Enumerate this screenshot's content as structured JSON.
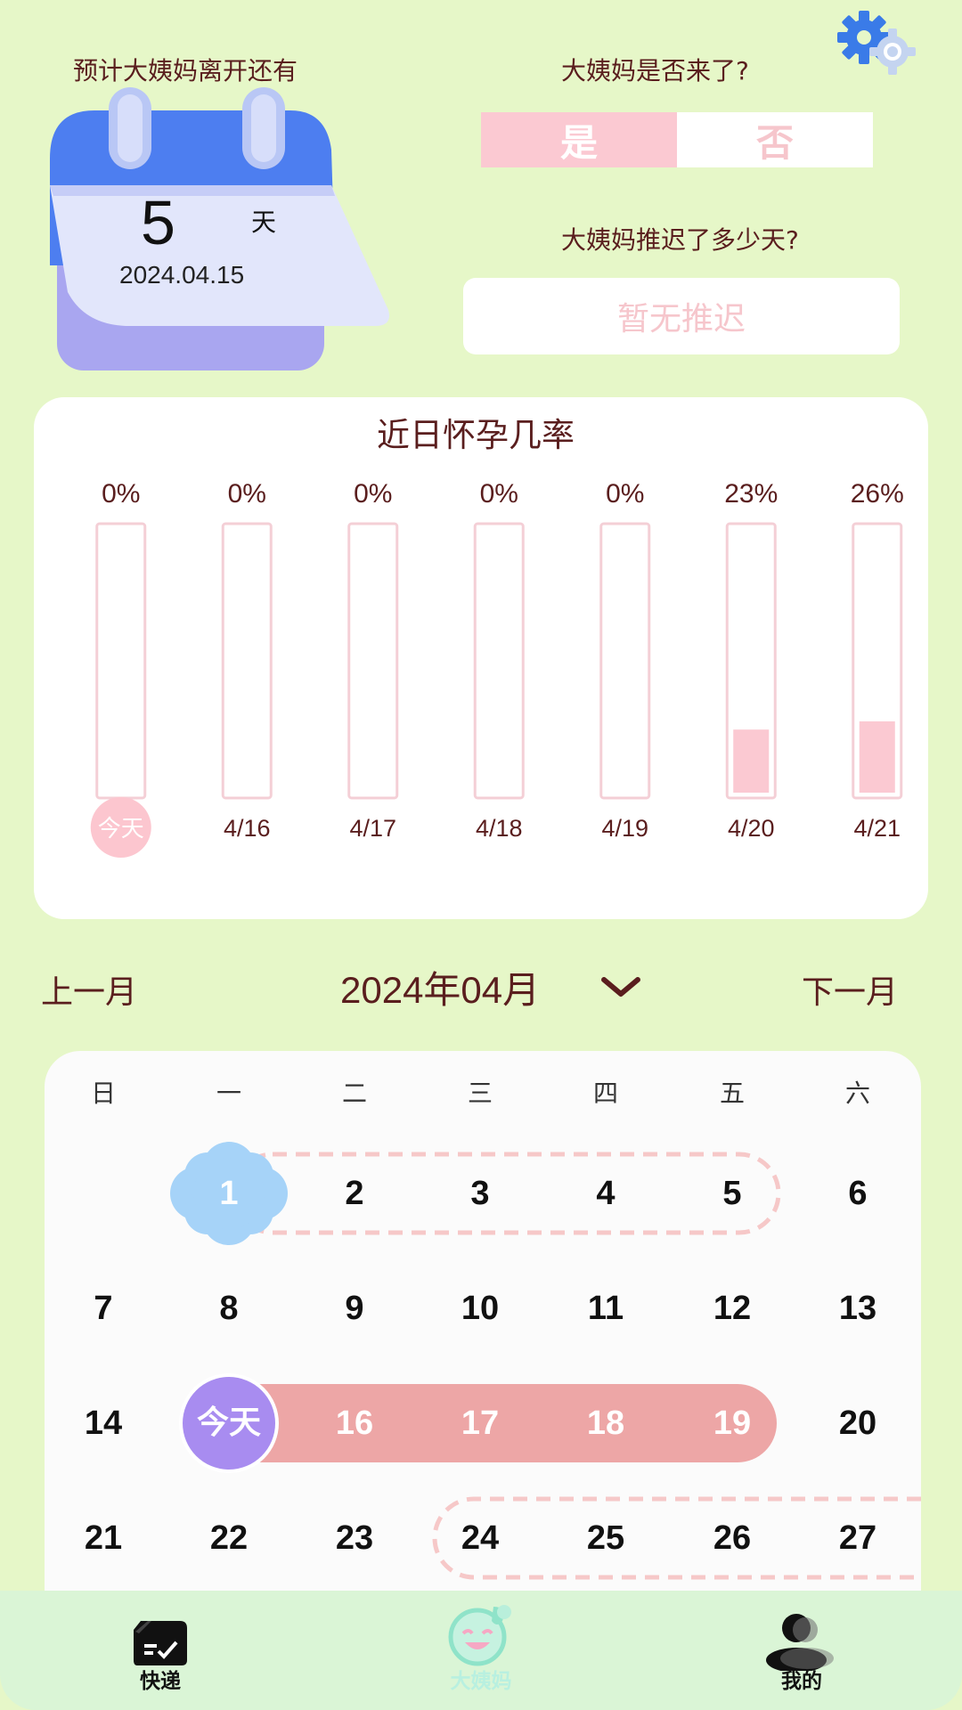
{
  "countdown": {
    "label": "预计大姨妈离开还有",
    "days": "5",
    "unit": "天",
    "date": "2024.04.15"
  },
  "period_question": {
    "label": "大姨妈是否来了?",
    "yes": "是",
    "no": "否",
    "selected": "是"
  },
  "delay": {
    "label": "大姨妈推迟了多少天?",
    "value": "暂无推迟"
  },
  "chart_data": {
    "type": "bar",
    "title": "近日怀孕几率",
    "categories": [
      "今天",
      "4/16",
      "4/17",
      "4/18",
      "4/19",
      "4/20",
      "4/21"
    ],
    "value_labels": [
      "0%",
      "0%",
      "0%",
      "0%",
      "0%",
      "23%",
      "26%"
    ],
    "values": [
      0,
      0,
      0,
      0,
      0,
      23,
      26
    ],
    "ylim": [
      0,
      100
    ],
    "colors": {
      "bar": "#fbc9d2",
      "outline": "#f4cfd6",
      "today_badge": "#fcc6cf"
    }
  },
  "month_nav": {
    "prev": "上一月",
    "title": "2024年04月",
    "next": "下一月"
  },
  "calendar": {
    "weekdays": [
      "日",
      "一",
      "二",
      "三",
      "四",
      "五",
      "六"
    ],
    "weeks": [
      [
        "",
        "1",
        "2",
        "3",
        "4",
        "5",
        "6"
      ],
      [
        "7",
        "8",
        "9",
        "10",
        "11",
        "12",
        "13"
      ],
      [
        "14",
        "今天",
        "16",
        "17",
        "18",
        "19",
        "20"
      ],
      [
        "21",
        "22",
        "23",
        "24",
        "25",
        "26",
        "27"
      ]
    ],
    "colors": {
      "period_band": "#eda6a6",
      "today": "#a88cf0",
      "cloud": "#a6d3f8",
      "dashed": "#f6c8c8"
    }
  },
  "bottom_nav": {
    "items": [
      {
        "label": "快递",
        "icon": "package-check-icon"
      },
      {
        "label": "大姨妈",
        "icon": "smiley-face-icon"
      },
      {
        "label": "我的",
        "icon": "user-silhouette-icon"
      }
    ]
  },
  "colors": {
    "background": "#e6f7c8",
    "text": "#5a1e1e",
    "pink": "#fbc9d2"
  }
}
